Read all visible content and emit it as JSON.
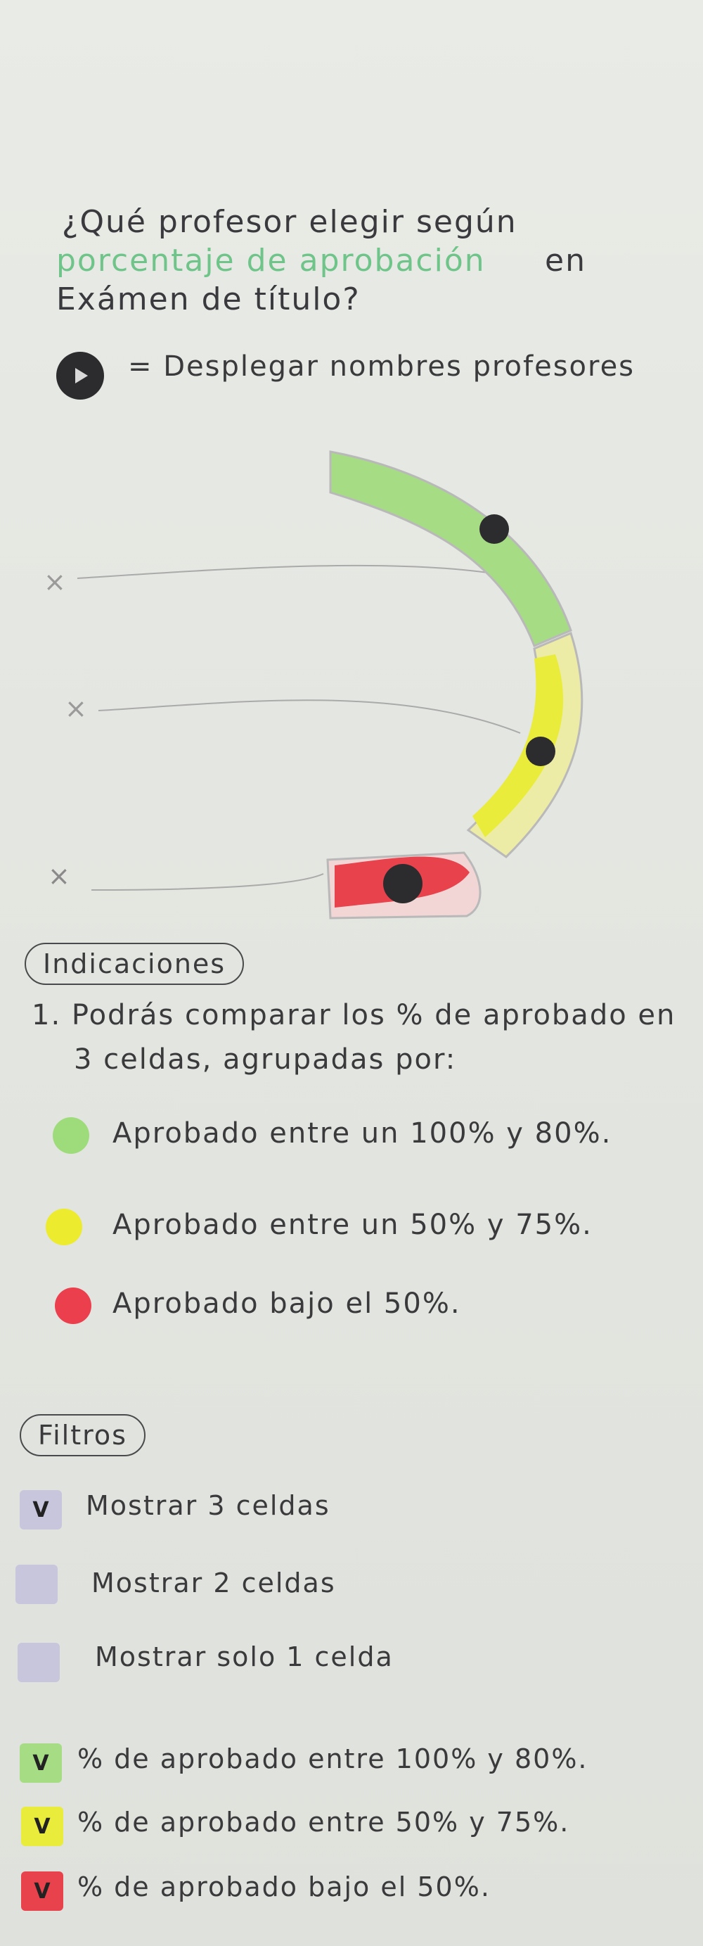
{
  "question": {
    "line1": "¿Qué profesor elegir según",
    "line2_highlight": "porcentaje de aprobación",
    "line2_rest": "en",
    "line3": "Exámen de título?"
  },
  "legend": {
    "icon": "play-icon",
    "text": "= Desplegar nombres profesores"
  },
  "diagram": {
    "markers": [
      "×",
      "×",
      "×"
    ],
    "segments": [
      "green",
      "yellow",
      "red"
    ]
  },
  "indicaciones": {
    "title": "Indicaciones",
    "line1": "1. Podrás comparar los % de aprobado en",
    "line2": "3 celdas, agrupadas por:",
    "items": [
      {
        "color": "#9edb7a",
        "text": "Aprobado entre un 100% y 80%."
      },
      {
        "color": "#eceb2e",
        "text": "Aprobado entre un 50% y 75%."
      },
      {
        "color": "#ec3f4e",
        "text": "Aprobado bajo el 50%."
      }
    ]
  },
  "filtros": {
    "title": "Filtros",
    "items": [
      {
        "label": "Mostrar 3 celdas",
        "checked": "V",
        "color": "#c8c6dc"
      },
      {
        "label": "Mostrar 2 celdas",
        "checked": "",
        "color": "#c8c6dc"
      },
      {
        "label": "Mostrar solo 1 celda",
        "checked": "",
        "color": "#c8c6dc"
      },
      {
        "label": "% de aprobado entre 100% y 80%.",
        "checked": "V",
        "color": "#a6dd84"
      },
      {
        "label": "% de aprobado entre 50% y 75%.",
        "checked": "V",
        "color": "#e9ec3a"
      },
      {
        "label": "% de aprobado bajo el 50%.",
        "checked": "V",
        "color": "#e8424c"
      }
    ]
  },
  "colors": {
    "green": "#9edb7a",
    "yellow": "#eceb2e",
    "red": "#ec3f4e",
    "ink": "#3a3a3e",
    "purple": "#c8c6dc"
  }
}
